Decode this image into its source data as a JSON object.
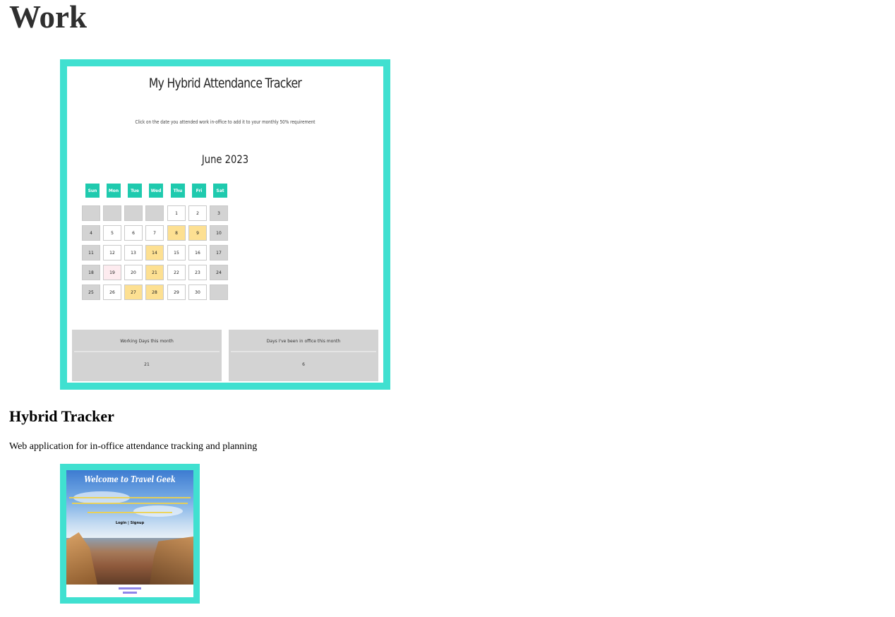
{
  "page": {
    "heading": "Work"
  },
  "projects": [
    {
      "title": "Hybrid Tracker",
      "description": "Web application for in-office attendance tracking and planning",
      "screenshot": {
        "app_title": "My Hybrid Attendance Tracker",
        "instructions": "Click on the date you attended work in-office to add it to your monthly 50% requirement",
        "month": "June 2023",
        "weekdays": [
          "Sun",
          "Mon",
          "Tue",
          "Wed",
          "Thu",
          "Fri",
          "Sat"
        ],
        "weeks": [
          [
            "",
            "",
            "",
            "",
            "1",
            "2",
            "3"
          ],
          [
            "4",
            "5",
            "6",
            "7",
            "8",
            "9",
            "10"
          ],
          [
            "11",
            "12",
            "13",
            "14",
            "15",
            "16",
            "17"
          ],
          [
            "18",
            "19",
            "20",
            "21",
            "22",
            "23",
            "24"
          ],
          [
            "25",
            "26",
            "27",
            "28",
            "29",
            "30",
            ""
          ]
        ],
        "attended_days": [
          "8",
          "9",
          "14",
          "21",
          "27",
          "28"
        ],
        "holiday_days": [
          "19"
        ],
        "stats": [
          {
            "label": "Working Days this month",
            "value": "21"
          },
          {
            "label": "Days I've been in office this month",
            "value": "6"
          }
        ],
        "colors": {
          "frame": "#40E0D0",
          "weekday_header": "#1fcaae",
          "attended": "#fde092",
          "weekend": "#d3d3d3",
          "holiday": "#fdebef"
        }
      }
    },
    {
      "title": "",
      "description": "",
      "screenshot": {
        "app_title": "Welcome to Travel Geek",
        "login_text": "Login | Signup"
      }
    }
  ]
}
